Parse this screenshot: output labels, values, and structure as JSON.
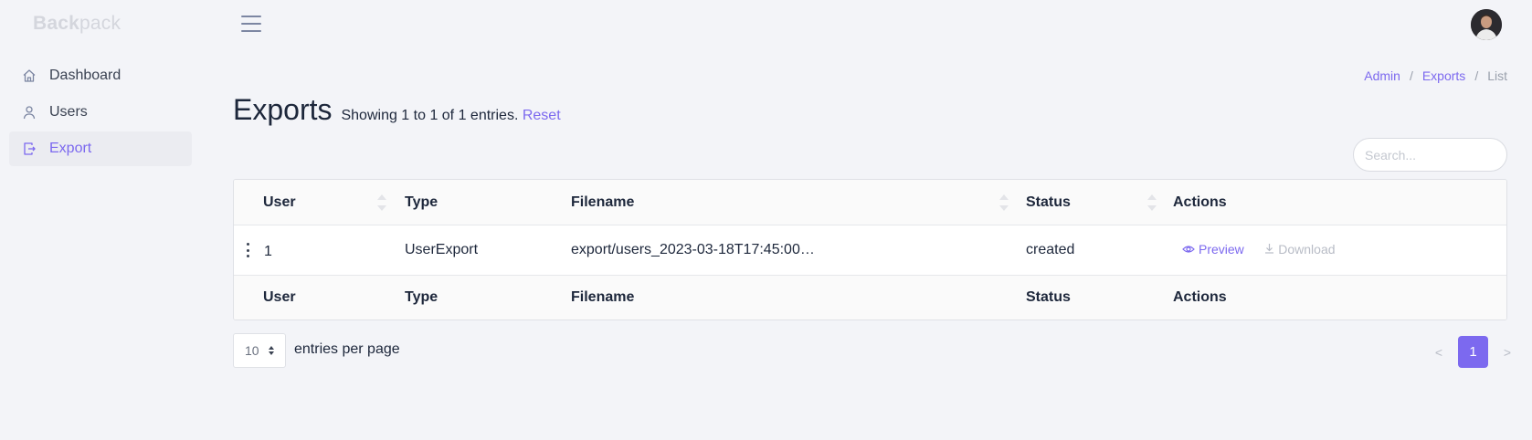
{
  "brand": {
    "bold": "Back",
    "light": "pack"
  },
  "sidebar": {
    "items": [
      {
        "label": "Dashboard",
        "icon": "home-icon",
        "active": false
      },
      {
        "label": "Users",
        "icon": "user-icon",
        "active": false
      },
      {
        "label": "Export",
        "icon": "export-icon",
        "active": true
      }
    ]
  },
  "breadcrumb": {
    "items": [
      "Admin",
      "Exports",
      "List"
    ],
    "separator": "/"
  },
  "page": {
    "title": "Exports",
    "subtitle": "Showing 1 to 1 of 1 entries.",
    "reset_label": "Reset"
  },
  "search": {
    "placeholder": "Search...",
    "value": ""
  },
  "table": {
    "columns": [
      "User",
      "Type",
      "Filename",
      "Status",
      "Actions"
    ],
    "rows": [
      {
        "user": "1",
        "type": "UserExport",
        "filename": "export/users_2023-03-18T17:45:00…",
        "status": "created",
        "actions": {
          "preview": "Preview",
          "download": "Download"
        }
      }
    ]
  },
  "pagination": {
    "per_page": "10",
    "per_page_label": "entries per page",
    "prev": "<",
    "next": ">",
    "current_page": "1"
  },
  "colors": {
    "accent": "#7c69ef",
    "background": "#f3f4f8",
    "text": "#1d273b",
    "muted": "#b8bcc6"
  }
}
